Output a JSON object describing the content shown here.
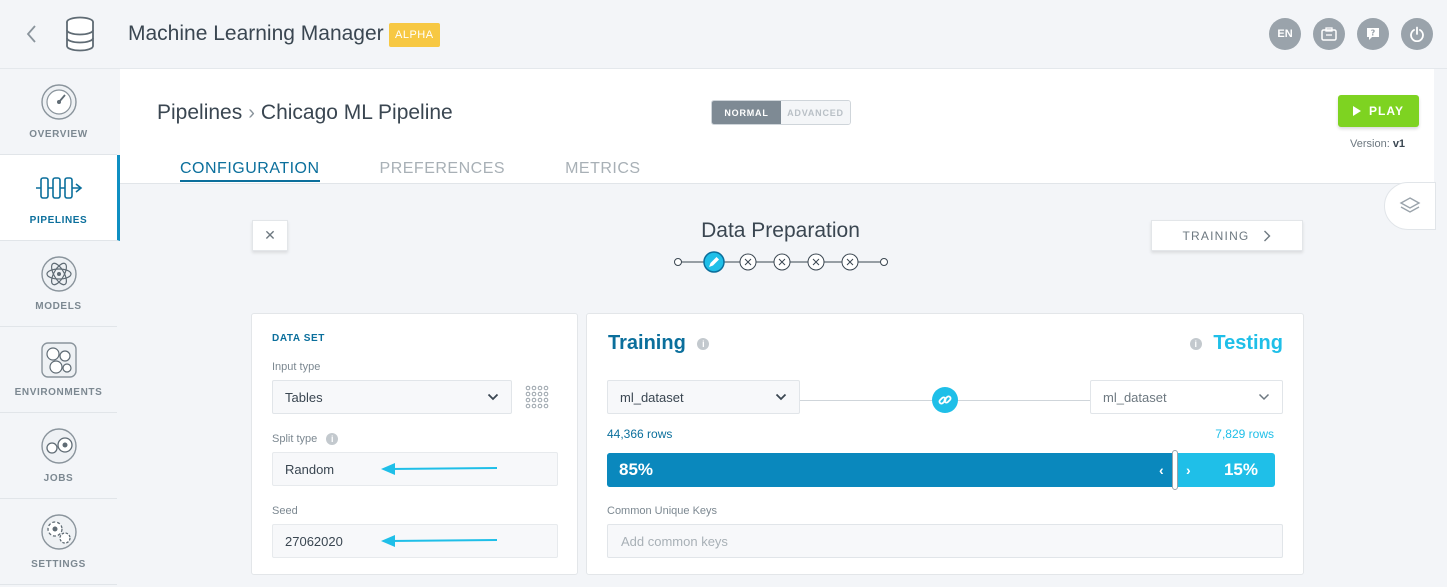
{
  "app": {
    "title": "Machine Learning Manager",
    "badge": "ALPHA"
  },
  "topbar": {
    "lang": "EN"
  },
  "sidebar": {
    "items": [
      {
        "label": "OVERVIEW"
      },
      {
        "label": "PIPELINES"
      },
      {
        "label": "MODELS"
      },
      {
        "label": "ENVIRONMENTS"
      },
      {
        "label": "JOBS"
      },
      {
        "label": "SETTINGS"
      }
    ]
  },
  "header": {
    "breadcrumb": [
      "Pipelines",
      "Chicago ML Pipeline"
    ],
    "mode_normal": "NORMAL",
    "mode_advanced": "ADVANCED",
    "play_label": "PLAY",
    "version_label": "Version:",
    "version_value": "v1",
    "tabs": [
      {
        "label": "CONFIGURATION"
      },
      {
        "label": "PREFERENCES"
      },
      {
        "label": "METRICS"
      }
    ]
  },
  "steps": {
    "title": "Data Preparation",
    "next_label": "TRAINING",
    "close_symbol": "✕"
  },
  "dataset": {
    "title": "DATA SET",
    "input_type_label": "Input type",
    "input_type_value": "Tables",
    "split_type_label": "Split type",
    "split_type_value": "Random",
    "seed_label": "Seed",
    "seed_value": "27062020"
  },
  "split": {
    "training_title": "Training",
    "testing_title": "Testing",
    "training_dataset": "ml_dataset",
    "testing_dataset": "ml_dataset",
    "training_rows": "44,366 rows",
    "testing_rows": "7,829 rows",
    "training_pct": "85%",
    "testing_pct": "15%",
    "training_fraction": 0.85,
    "keys_label": "Common Unique Keys",
    "keys_placeholder": "Add common keys"
  },
  "colors": {
    "primary": "#0b6f9c",
    "accent": "#1fbfe8",
    "play": "#7ed321",
    "badge": "#f7c843"
  }
}
